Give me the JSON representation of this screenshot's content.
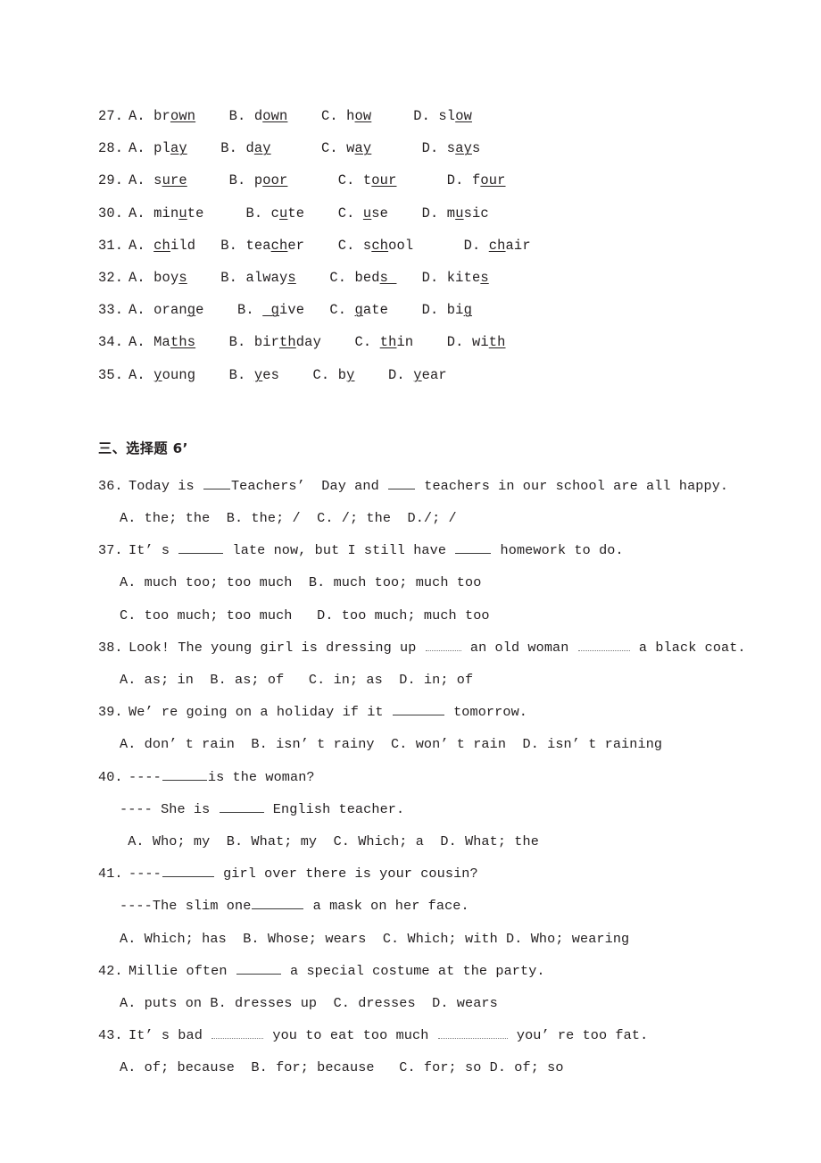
{
  "document": {
    "language": "en-zh",
    "page_background": "#ffffff",
    "text_color": "#231f20"
  },
  "phonetics_section": {
    "name": "phonetics-multiple-choice",
    "rows": [
      {
        "number": "27.",
        "options": [
          {
            "letter": "A.",
            "pre": "br",
            "underlined": "own",
            "post": "",
            "gap": "    "
          },
          {
            "letter": "B.",
            "pre": "d",
            "underlined": "own",
            "post": "",
            "gap": "    "
          },
          {
            "letter": "C.",
            "pre": "h",
            "underlined": "ow",
            "post": "",
            "gap": "     "
          },
          {
            "letter": "D.",
            "pre": "sl",
            "underlined": "ow",
            "post": "",
            "gap": ""
          }
        ]
      },
      {
        "number": "28.",
        "options": [
          {
            "letter": "A.",
            "pre": "pl",
            "underlined": "ay",
            "post": "",
            "gap": "    "
          },
          {
            "letter": "B.",
            "pre": "d",
            "underlined": "ay",
            "post": "",
            "gap": "      "
          },
          {
            "letter": "C.",
            "pre": "w",
            "underlined": "ay",
            "post": "",
            "gap": "      "
          },
          {
            "letter": "D.",
            "pre": "s",
            "underlined": "ay",
            "post": "s",
            "gap": ""
          }
        ]
      },
      {
        "number": "29.",
        "options": [
          {
            "letter": "A.",
            "pre": "s",
            "underlined": "ure",
            "post": "",
            "gap": "     "
          },
          {
            "letter": "B.",
            "pre": "p",
            "underlined": "oor",
            "post": "",
            "gap": "      "
          },
          {
            "letter": "C.",
            "pre": "t",
            "underlined": "our",
            "post": "",
            "gap": "      "
          },
          {
            "letter": "D.",
            "pre": "f",
            "underlined": "our",
            "post": "",
            "gap": ""
          }
        ]
      },
      {
        "number": "30.",
        "options": [
          {
            "letter": "A.",
            "pre": "min",
            "underlined": "u",
            "post": "te",
            "gap": "     "
          },
          {
            "letter": "B.",
            "pre": "c",
            "underlined": "u",
            "post": "te",
            "gap": "    "
          },
          {
            "letter": "C.",
            "pre": "",
            "underlined": "u",
            "post": "se",
            "gap": "    "
          },
          {
            "letter": "D.",
            "pre": "m",
            "underlined": "u",
            "post": "sic",
            "gap": ""
          }
        ]
      },
      {
        "number": "31.",
        "options": [
          {
            "letter": "A.",
            "pre": "",
            "underlined": "ch",
            "post": "ild",
            "gap": "   "
          },
          {
            "letter": "B.",
            "pre": "tea",
            "underlined": "ch",
            "post": "er",
            "gap": "    "
          },
          {
            "letter": "C.",
            "pre": "s",
            "underlined": "ch",
            "post": "ool",
            "gap": "      "
          },
          {
            "letter": "D.",
            "pre": "",
            "underlined": "ch",
            "post": "air",
            "gap": ""
          }
        ]
      },
      {
        "number": "32.",
        "options": [
          {
            "letter": "A.",
            "pre": "boy",
            "underlined": "s",
            "post": "",
            "gap": "    "
          },
          {
            "letter": "B.",
            "pre": "alway",
            "underlined": "s",
            "post": "",
            "gap": "    "
          },
          {
            "letter": "C.",
            "pre": "bed",
            "underlined": "s ",
            "post": "",
            "gap": "   "
          },
          {
            "letter": "D.",
            "pre": "kite",
            "underlined": "s",
            "post": "",
            "gap": ""
          }
        ]
      },
      {
        "number": "33.",
        "options": [
          {
            "letter": "A.",
            "pre": "oran",
            "underlined": "g",
            "post": "e",
            "gap": "    "
          },
          {
            "letter": "B.",
            "pre": "",
            "underlined": " g",
            "post": "ive",
            "gap": "   "
          },
          {
            "letter": "C.",
            "pre": "",
            "underlined": "g",
            "post": "ate",
            "gap": "    "
          },
          {
            "letter": "D.",
            "pre": "bi",
            "underlined": "g",
            "post": "",
            "gap": ""
          }
        ]
      },
      {
        "number": "34.",
        "options": [
          {
            "letter": "A.",
            "pre": "Ma",
            "underlined": "ths",
            "post": "",
            "gap": "    "
          },
          {
            "letter": "B.",
            "pre": "bir",
            "underlined": "th",
            "post": "day",
            "gap": "    "
          },
          {
            "letter": "C.",
            "pre": "",
            "underlined": "th",
            "post": "in",
            "gap": "    "
          },
          {
            "letter": "D.",
            "pre": "wi",
            "underlined": "th",
            "post": "",
            "gap": ""
          }
        ]
      },
      {
        "number": "35.",
        "options": [
          {
            "letter": "A.",
            "pre": "",
            "underlined": "y",
            "post": "oung",
            "gap": "    "
          },
          {
            "letter": "B.",
            "pre": "",
            "underlined": "y",
            "post": "es",
            "gap": "    "
          },
          {
            "letter": "C.",
            "pre": "b",
            "underlined": "y",
            "post": "",
            "gap": "    "
          },
          {
            "letter": "D.",
            "pre": "",
            "underlined": "y",
            "post": "ear",
            "gap": ""
          }
        ]
      }
    ]
  },
  "choice_section": {
    "heading": "三、选择题 6’",
    "questions": [
      {
        "number": "36.",
        "stem_parts": [
          {
            "t": "text",
            "v": "Today is "
          },
          {
            "t": "blank",
            "w": "b3"
          },
          {
            "t": "text",
            "v": "Teachers’  Day and "
          },
          {
            "t": "blank",
            "w": "b3"
          },
          {
            "t": "text",
            "v": " teachers in our school are all happy."
          }
        ],
        "answers": "A. the; the  B. the; /  C. /; the  D./; /"
      },
      {
        "number": "37.",
        "stem_parts": [
          {
            "t": "text",
            "v": "It’ s "
          },
          {
            "t": "blank",
            "w": "b5"
          },
          {
            "t": "text",
            "v": " late now, but I still have "
          },
          {
            "t": "blank",
            "w": "b4"
          },
          {
            "t": "text",
            "v": " homework to do."
          }
        ],
        "answers": "A. much too; too much  B. much too; much too",
        "answers2": "C. too much; too much   D. too much; much too"
      },
      {
        "number": "38.",
        "stem_parts": [
          {
            "t": "text",
            "v": "Look! The young girl is dressing up "
          },
          {
            "t": "dotted",
            "w": "b4"
          },
          {
            "t": "text",
            "v": " an old woman "
          },
          {
            "t": "dotted",
            "w": "b6"
          },
          {
            "t": "text",
            "v": " a black coat."
          }
        ],
        "answers": "A. as; in  B. as; of   C. in; as  D. in; of"
      },
      {
        "number": "39.",
        "stem_parts": [
          {
            "t": "text",
            "v": "We’ re going on a holiday if it "
          },
          {
            "t": "blank",
            "w": "b6"
          },
          {
            "t": "text",
            "v": " tomorrow."
          }
        ],
        "answers": "A. don’ t rain  B. isn’ t rainy  C. won’ t rain  D. isn’ t raining"
      },
      {
        "number": "40.",
        "stem_parts": [
          {
            "t": "text",
            "v": "----"
          },
          {
            "t": "blank",
            "w": "b5"
          },
          {
            "t": "text",
            "v": "is the woman?"
          }
        ],
        "sub_parts": [
          {
            "t": "text",
            "v": "---- She is "
          },
          {
            "t": "blank",
            "w": "b5"
          },
          {
            "t": "text",
            "v": " English teacher."
          }
        ],
        "answers": " A. Who; my  B. What; my  C. Which; a  D. What; the"
      },
      {
        "number": "41.",
        "stem_parts": [
          {
            "t": "text",
            "v": "----"
          },
          {
            "t": "blank",
            "w": "b6"
          },
          {
            "t": "text",
            "v": " girl over there is your cousin?"
          }
        ],
        "sub_parts": [
          {
            "t": "text",
            "v": "----The slim one"
          },
          {
            "t": "blank",
            "w": "b6"
          },
          {
            "t": "text",
            "v": " a mask on her face."
          }
        ],
        "answers": "A. Which; has  B. Whose; wears  C. Which; with D. Who; wearing"
      },
      {
        "number": "42.",
        "stem_parts": [
          {
            "t": "text",
            "v": "Millie often "
          },
          {
            "t": "blank",
            "w": "b5"
          },
          {
            "t": "text",
            "v": " a special costume at the party."
          }
        ],
        "answers": "A. puts on B. dresses up  C. dresses  D. wears"
      },
      {
        "number": "43.",
        "stem_parts": [
          {
            "t": "text",
            "v": "It’ s bad "
          },
          {
            "t": "dotted",
            "w": "b6"
          },
          {
            "t": "text",
            "v": " you to eat too much "
          },
          {
            "t": "dotted",
            "w": "b8"
          },
          {
            "t": "text",
            "v": " you’ re too fat."
          }
        ],
        "answers": "A. of; because  B. for; because   C. for; so D. of; so"
      }
    ]
  }
}
